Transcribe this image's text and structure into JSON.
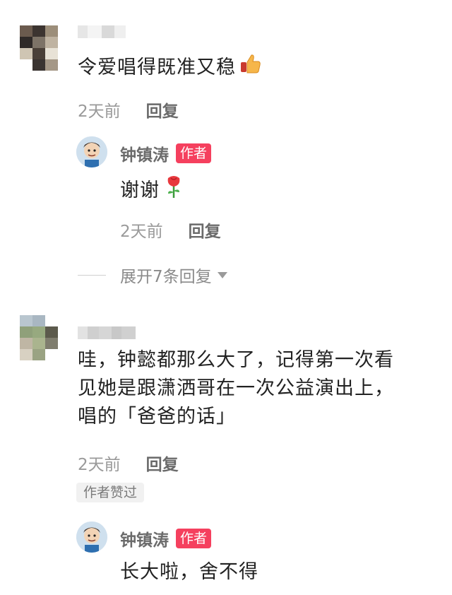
{
  "comments": [
    {
      "text": "令爱唱得既准又稳",
      "emoji": "thumbs-up-icon",
      "time": "2天前",
      "reply_label": "回复",
      "reply": {
        "author": "钟镇涛",
        "badge": "作者",
        "text": "谢谢",
        "emoji": "rose-icon",
        "time": "2天前",
        "reply_label": "回复"
      },
      "expand_label": "展开7条回复"
    },
    {
      "text_lines": [
        "哇，钟懿都那么大了，记得第一次看",
        "见她是跟潇洒哥在一次公益演出上，",
        "唱的「爸爸的话」"
      ],
      "time": "2天前",
      "reply_label": "回复",
      "liked_label": "作者赞过",
      "reply": {
        "author": "钟镇涛",
        "badge": "作者",
        "text": "长大啦，舍不得"
      }
    }
  ]
}
